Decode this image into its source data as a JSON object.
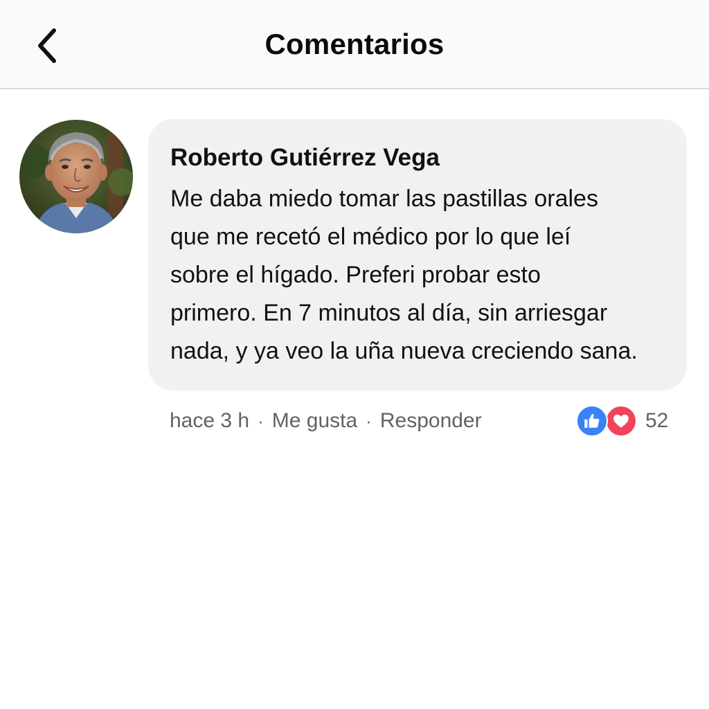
{
  "header": {
    "title": "Comentarios",
    "back_icon": "chevron-left-icon"
  },
  "comment": {
    "author": "Roberto Gutiérrez Vega",
    "text_lines": [
      "Me daba miedo tomar las pastillas orales",
      "que me recetó el médico por lo que leí",
      "sobre el hígado. Preferi probar esto",
      "primero. En 7 minutos al día, sin arriesgar",
      "nada, y ya veo la uña nueva creciendo sana."
    ],
    "time": "hace 3 h",
    "separator": "·",
    "like_label": "Me gusta",
    "reply_label": "Responder",
    "reactions": {
      "icons": [
        "thumbs-up-icon",
        "heart-icon"
      ],
      "count": "52",
      "like_color": "#3b82f6",
      "love_color": "#f0445a"
    }
  },
  "colors": {
    "bubble_bg": "#f0f1f3",
    "header_bg": "#fafafa",
    "meta_text": "#5f6368"
  }
}
